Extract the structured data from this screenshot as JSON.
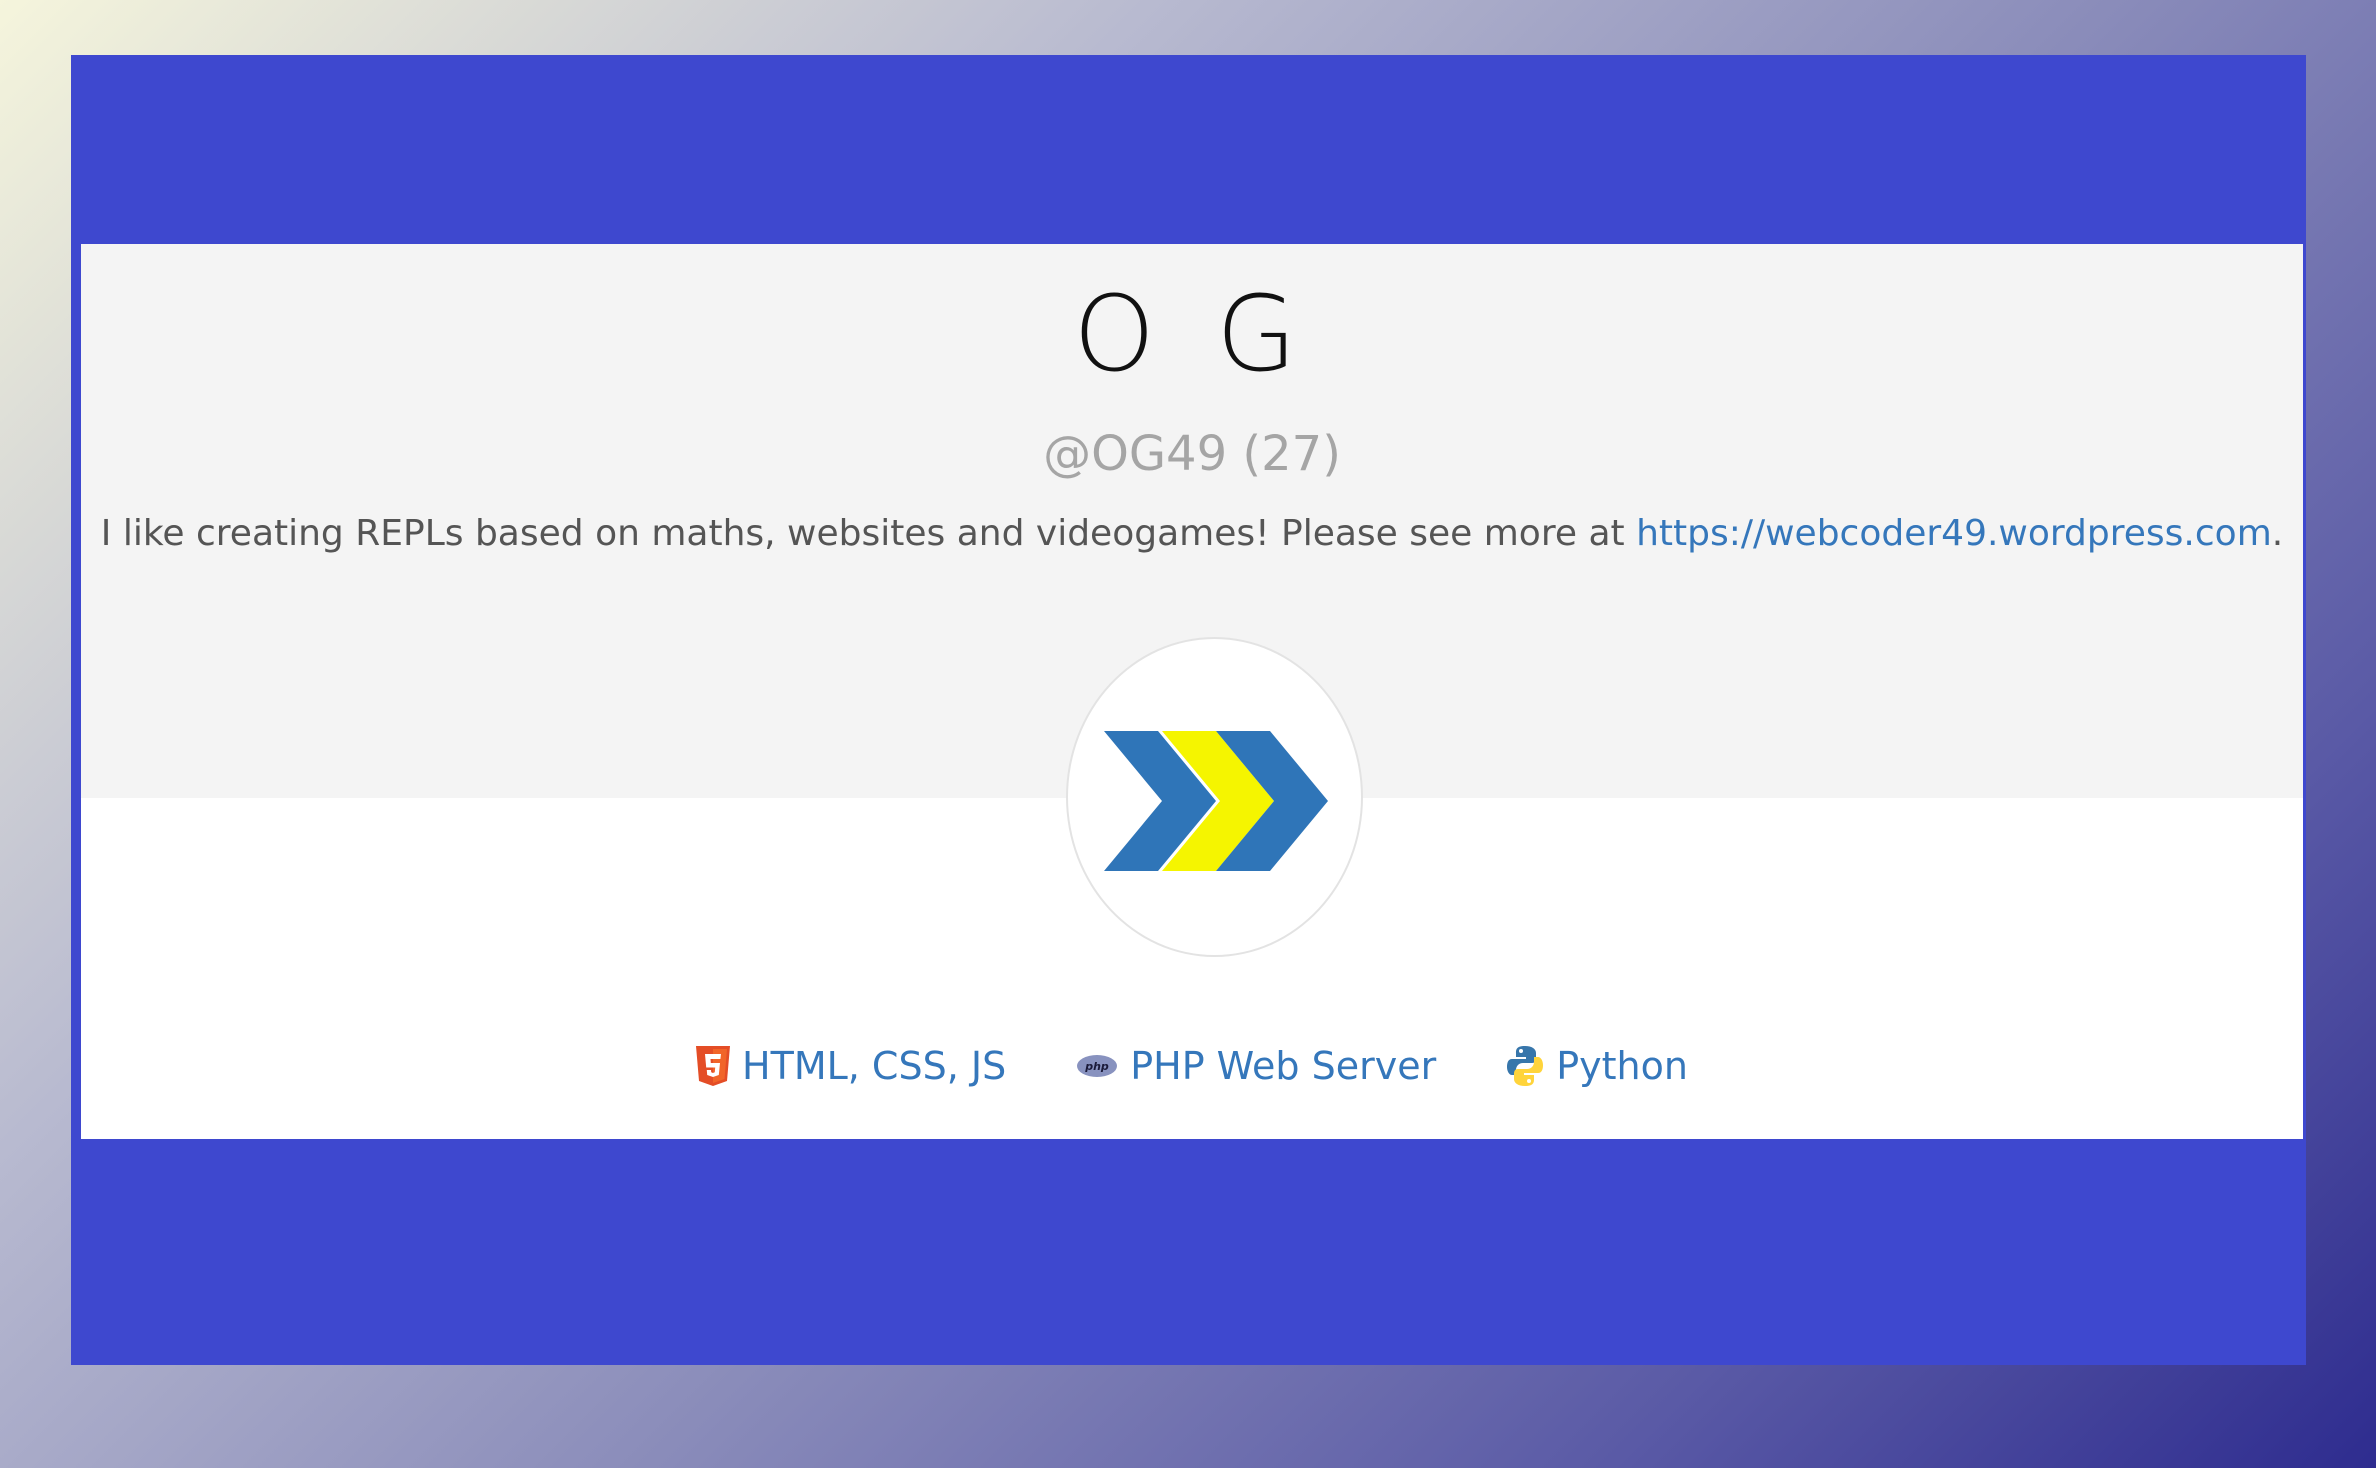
{
  "profile": {
    "display_name": "O G",
    "handle": "@OG49 (27)",
    "bio_text": "I like creating REPLs based on maths, websites and videogames! Please see more at ",
    "bio_link": "https://webcoder49.wordpress.com",
    "bio_suffix": ".",
    "avatar_icon": "double-chevron-logo-icon"
  },
  "languages": [
    {
      "label": "HTML, CSS, JS",
      "icon": "html5-icon"
    },
    {
      "label": "PHP Web Server",
      "icon": "php-icon"
    },
    {
      "label": "Python",
      "icon": "python-icon"
    }
  ],
  "colors": {
    "frame": "#3e48cf",
    "card_top": "#f4f4f4",
    "link": "#3577bb",
    "logo_blue": "#2f75b8",
    "logo_yellow": "#f5f500",
    "html5_orange": "#e44d26"
  }
}
